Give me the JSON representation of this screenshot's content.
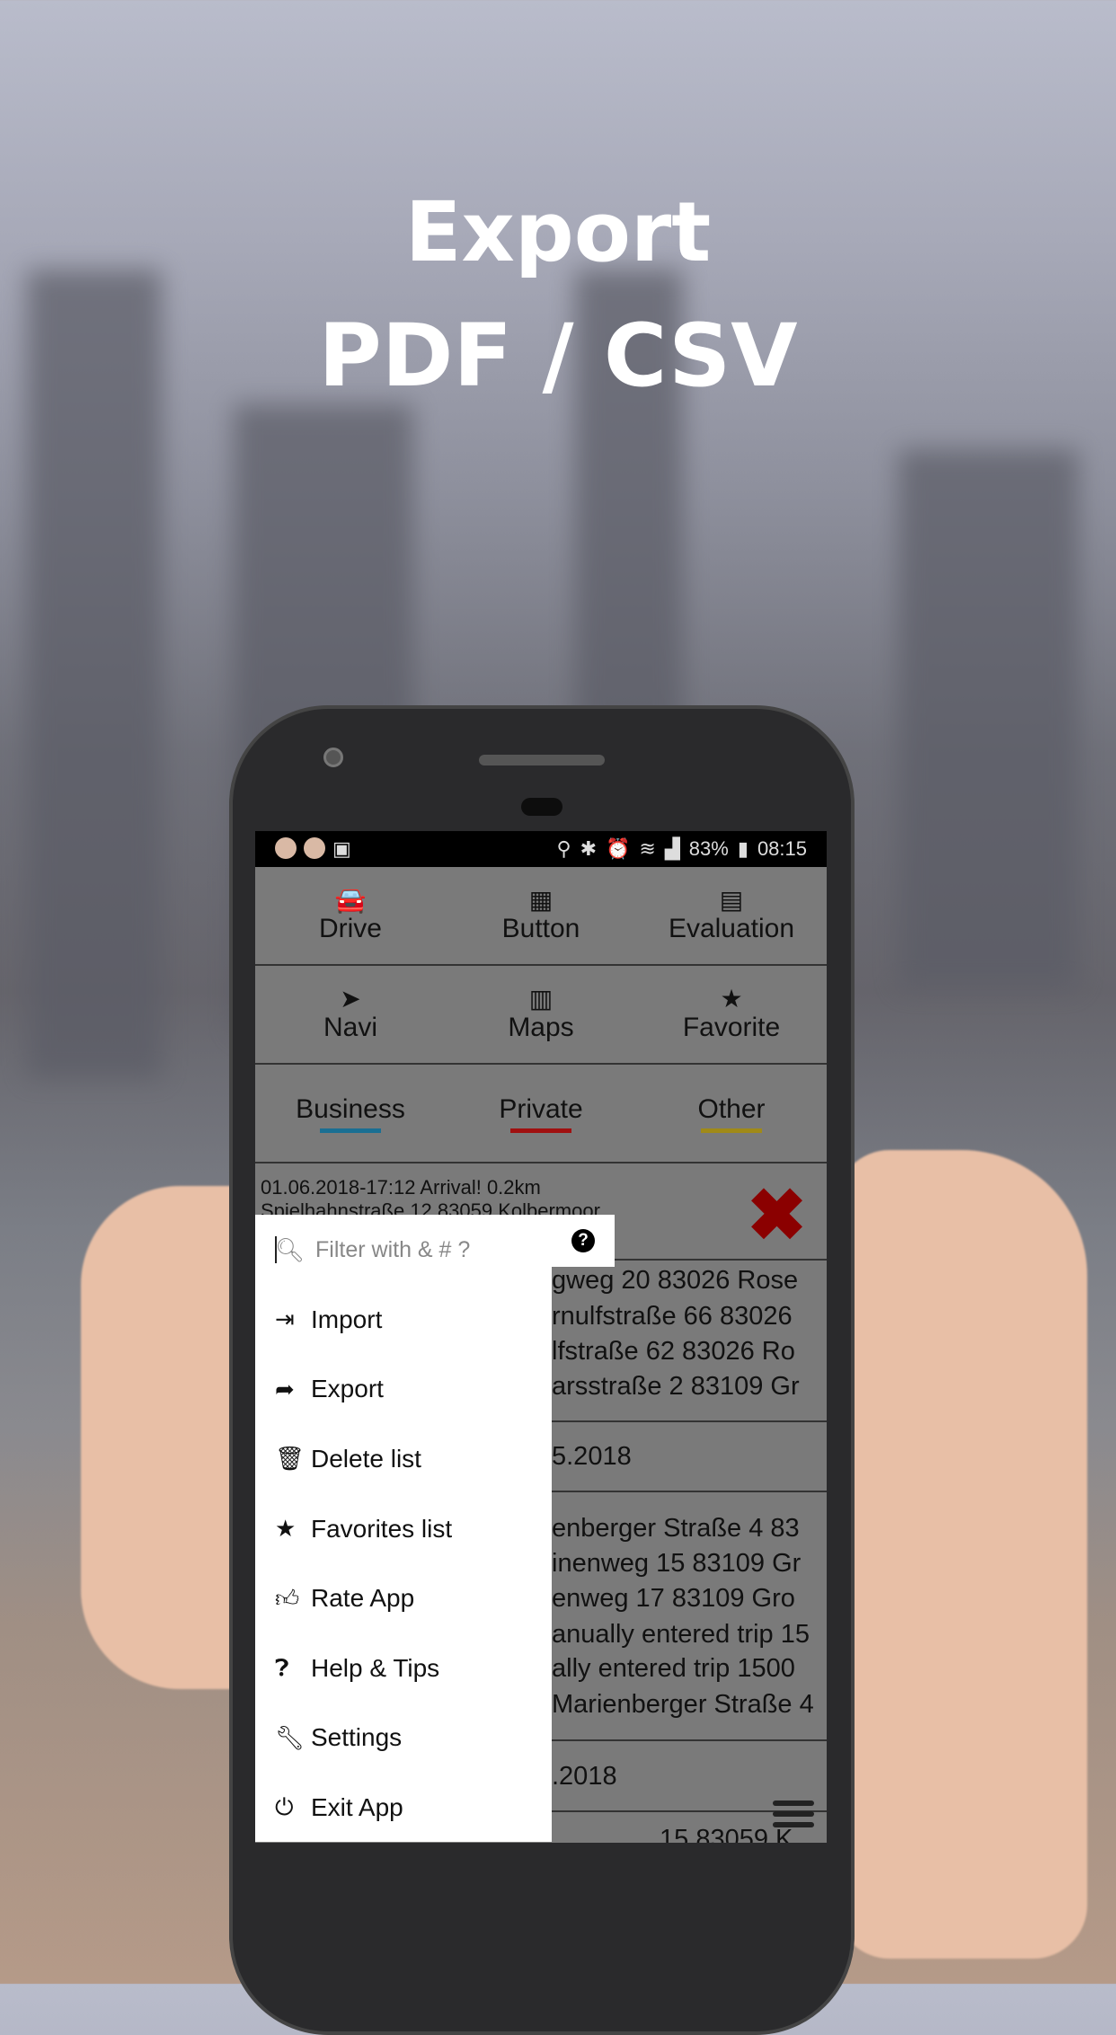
{
  "headline": {
    "line1": "Export",
    "line2": "PDF / CSV"
  },
  "status_bar": {
    "battery": "83%",
    "time": "08:15"
  },
  "toolbar": [
    {
      "label": "Drive",
      "icon": "car-icon"
    },
    {
      "label": "Button",
      "icon": "grid-icon"
    },
    {
      "label": "Evaluation",
      "icon": "report-icon"
    },
    {
      "label": "Navi",
      "icon": "navigation-arrow-icon"
    },
    {
      "label": "Maps",
      "icon": "map-icon"
    },
    {
      "label": "Favorite",
      "icon": "star-icon"
    }
  ],
  "tabs": [
    {
      "label": "Business",
      "color": "#1a6f93"
    },
    {
      "label": "Private",
      "color": "#a01010"
    },
    {
      "label": "Other",
      "color": "#a08a18"
    }
  ],
  "first_entry": {
    "line1": "01.06.2018-17:12 Arrival! 0.2km",
    "line2": "Spielhahnstraße 12 83059 Kolbermoor"
  },
  "list_fragments": [
    "gweg 20 83026 Rose",
    "rnulfstraße 66 83026",
    "lfstraße 62 83026 Ro",
    "arsstraße 2 83109 Gr",
    "5.2018",
    "enberger Straße 4 83",
    "inenweg 15 83109 Gr",
    "enweg 17 83109 Gro",
    "anually entered trip 15",
    "ally entered trip 1500",
    "Marienberger Straße 4",
    ".2018",
    "15 83059 K"
  ],
  "menu": {
    "filter_placeholder": "Filter with & # ?",
    "items": [
      {
        "label": "Import",
        "icon": "sign-in-icon"
      },
      {
        "label": "Export",
        "icon": "sign-out-icon"
      },
      {
        "label": "Delete list",
        "icon": "trash-icon"
      },
      {
        "label": "Favorites list",
        "icon": "star-icon"
      },
      {
        "label": "Rate App",
        "icon": "thumbs-up-icon"
      },
      {
        "label": "Help & Tips",
        "icon": "question-circle-icon"
      },
      {
        "label": "Settings",
        "icon": "wrench-icon"
      },
      {
        "label": "Exit App",
        "icon": "power-icon"
      }
    ]
  }
}
